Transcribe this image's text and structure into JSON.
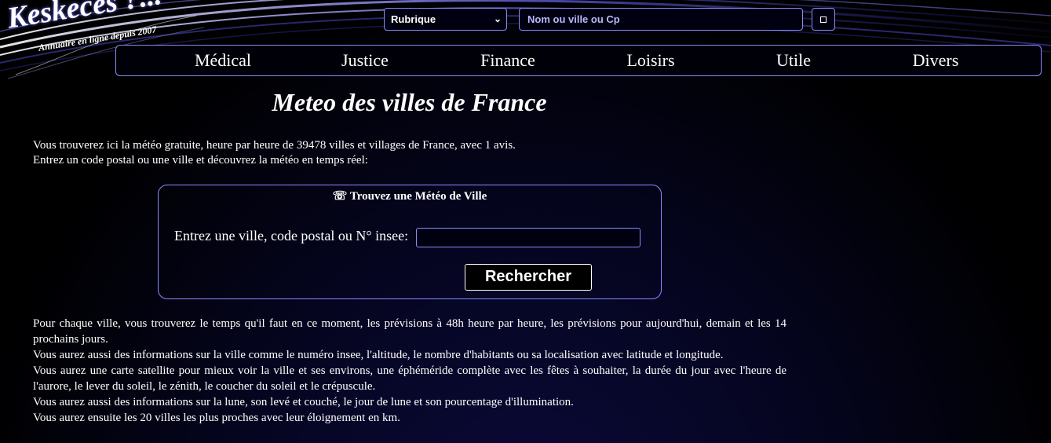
{
  "logo": {
    "title": "Keskeces ?...",
    "subtitle": "Annuaire en ligne depuis 2007"
  },
  "topbar": {
    "rubrique_label": "Rubrique",
    "search_placeholder": "Nom ou ville ou Cp"
  },
  "nav": {
    "items": [
      {
        "label": "Médical"
      },
      {
        "label": "Justice"
      },
      {
        "label": "Finance"
      },
      {
        "label": "Loisirs"
      },
      {
        "label": "Utile"
      },
      {
        "label": "Divers"
      }
    ]
  },
  "page": {
    "title": "Meteo des villes de France",
    "intro": [
      "Vous trouverez ici la météo gratuite, heure par heure de 39478 villes et villages de France, avec 1 avis.",
      "Entrez un code postal ou une ville et découvrez la météo en temps réel:"
    ]
  },
  "finder": {
    "title": "☏ Trouvez une Météo de Ville",
    "label": "Entrez une ville, code postal ou N° insee:",
    "button": "Rechercher"
  },
  "details": [
    "Pour chaque ville, vous trouverez le temps qu'il faut en ce moment, les prévisions à 48h heure par heure, les prévisions pour aujourd'hui, demain et les 14 prochains jours.",
    "Vous aurez aussi des informations sur la ville comme le numéro insee, l'altitude, le nombre d'habitants ou sa localisation avec latitude et longitude.",
    "Vous aurez une carte satellite pour mieux voir la ville et ses environs, une éphéméride complète avec les fêtes à souhaiter, la durée du jour avec l'heure de l'aurore, le lever du soleil, le zénith, le coucher du soleil et le crépuscule.",
    "Vous aurez aussi des informations sur la lune, son levé et couché, le jour de lune et son pourcentage d'illumination.",
    "Vous aurez ensuite les 20 villes les plus proches avec leur éloignement en km."
  ]
}
